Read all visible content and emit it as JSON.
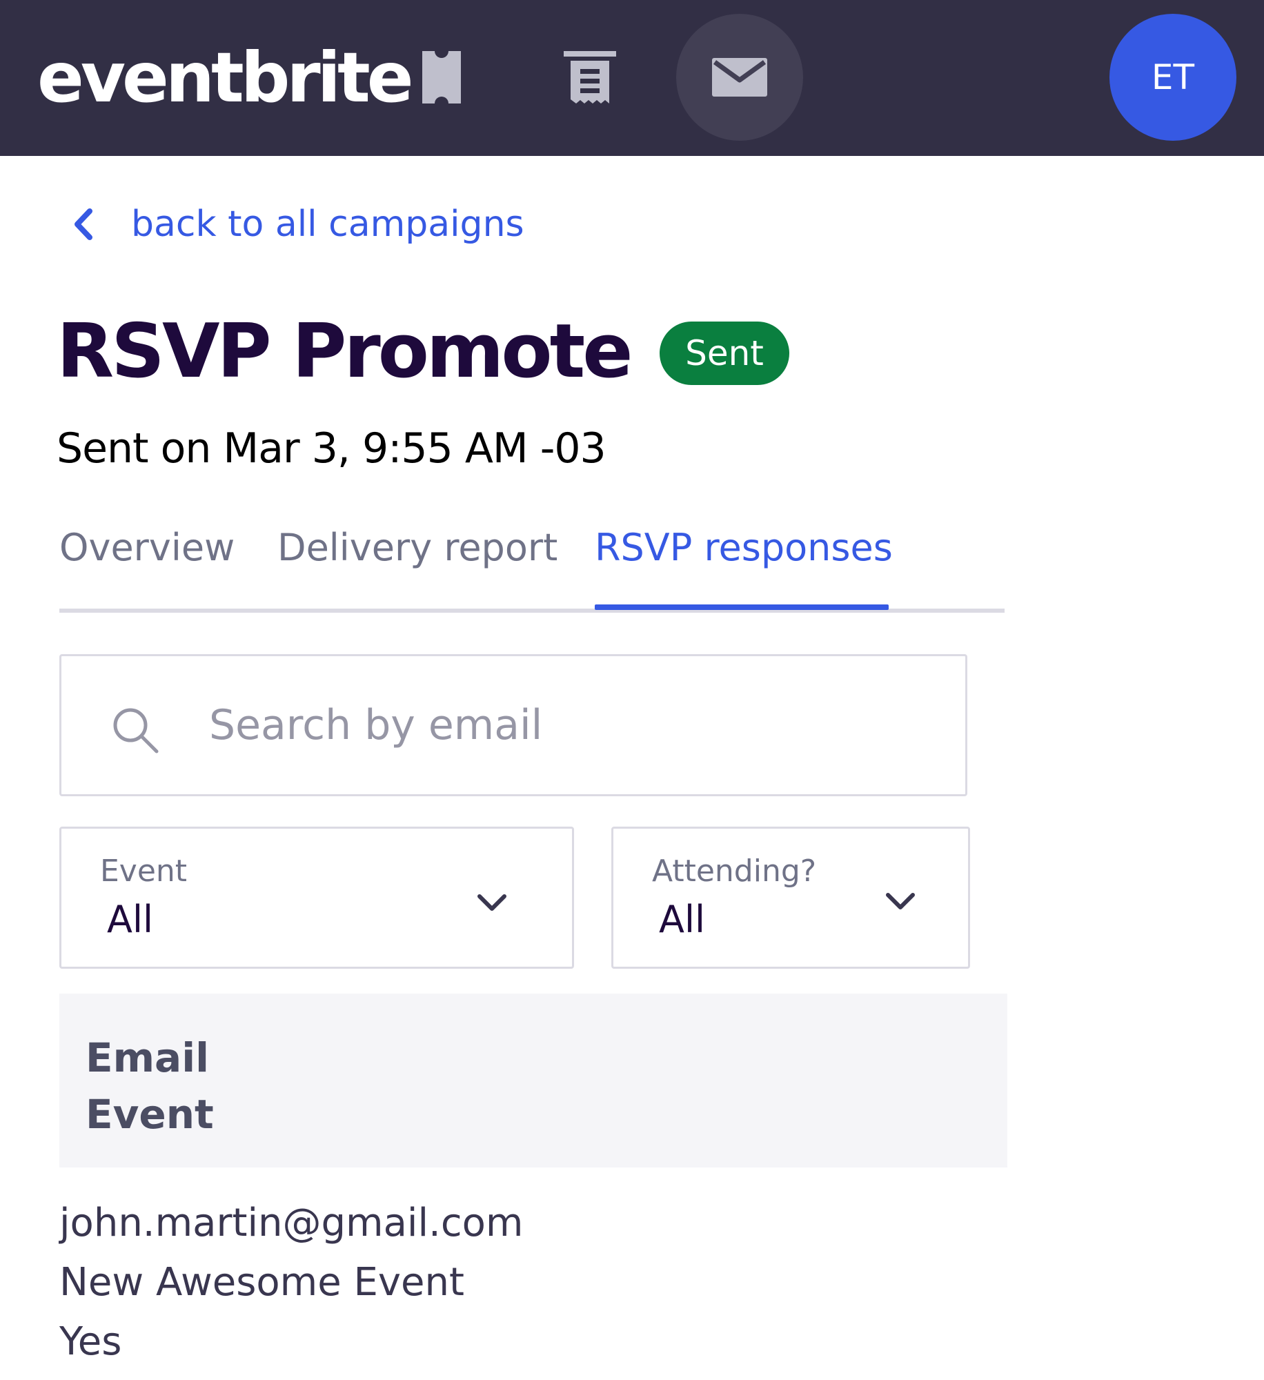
{
  "header": {
    "logo_text": "eventbrite",
    "nav": [
      {
        "icon": "ticket-icon",
        "active": false
      },
      {
        "icon": "orders-icon",
        "active": false
      },
      {
        "icon": "mail-icon",
        "active": true
      }
    ],
    "avatar_initials": "ET",
    "colors": {
      "bar": "#322f45",
      "avatar": "#3659e3"
    }
  },
  "back_link": {
    "label": "back to all campaigns",
    "icon": "chevron-left-icon"
  },
  "campaign": {
    "title": "RSVP Promote",
    "status_badge": "Sent",
    "sent_on": "Sent on Mar 3, 9:55 AM -03",
    "colors": {
      "badge": "#0a7f3f",
      "accent": "#3659e3"
    }
  },
  "tabs": [
    {
      "label": "Overview",
      "active": false
    },
    {
      "label": "Delivery report",
      "active": false
    },
    {
      "label": "RSVP responses",
      "active": true
    }
  ],
  "search": {
    "placeholder": "Search by email",
    "value": "",
    "icon": "search-icon"
  },
  "filters": {
    "event": {
      "label": "Event",
      "value": "All"
    },
    "attending": {
      "label": "Attending?",
      "value": "All"
    }
  },
  "table": {
    "headers": [
      "Email",
      "Event"
    ],
    "rows": [
      {
        "email": "john.martin@gmail.com",
        "event": "New Awesome Event",
        "attending": "Yes"
      }
    ]
  }
}
